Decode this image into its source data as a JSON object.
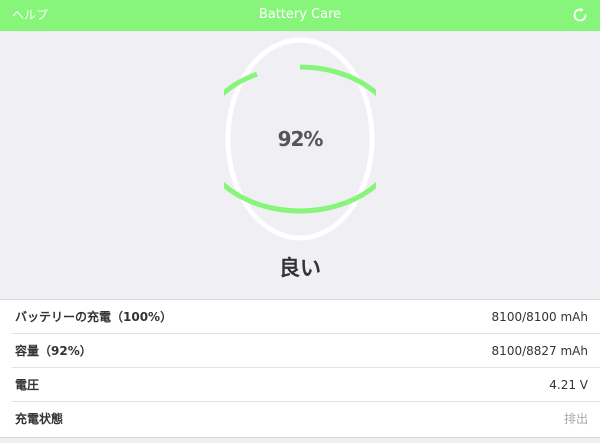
{
  "header": {
    "help_label": "ヘルプ",
    "title": "Battery Care",
    "refresh_icon": "refresh-icon"
  },
  "gauge": {
    "value_text": "92%",
    "fraction": 0.92,
    "color_fill": "#86f57a",
    "color_track": "#ffffff"
  },
  "status": {
    "label": "良い"
  },
  "details": {
    "rows": [
      {
        "label": "バッテリーの充電（100%）",
        "value": "8100/8100 mAh"
      },
      {
        "label": "容量（92%）",
        "value": "8100/8827 mAh"
      },
      {
        "label": "電圧",
        "value": "4.21 V"
      },
      {
        "label": "充電状態",
        "value": "排出"
      }
    ]
  },
  "colors": {
    "accent": "#86f57a",
    "background": "#efeff4",
    "muted_text": "#a8a8a8"
  }
}
